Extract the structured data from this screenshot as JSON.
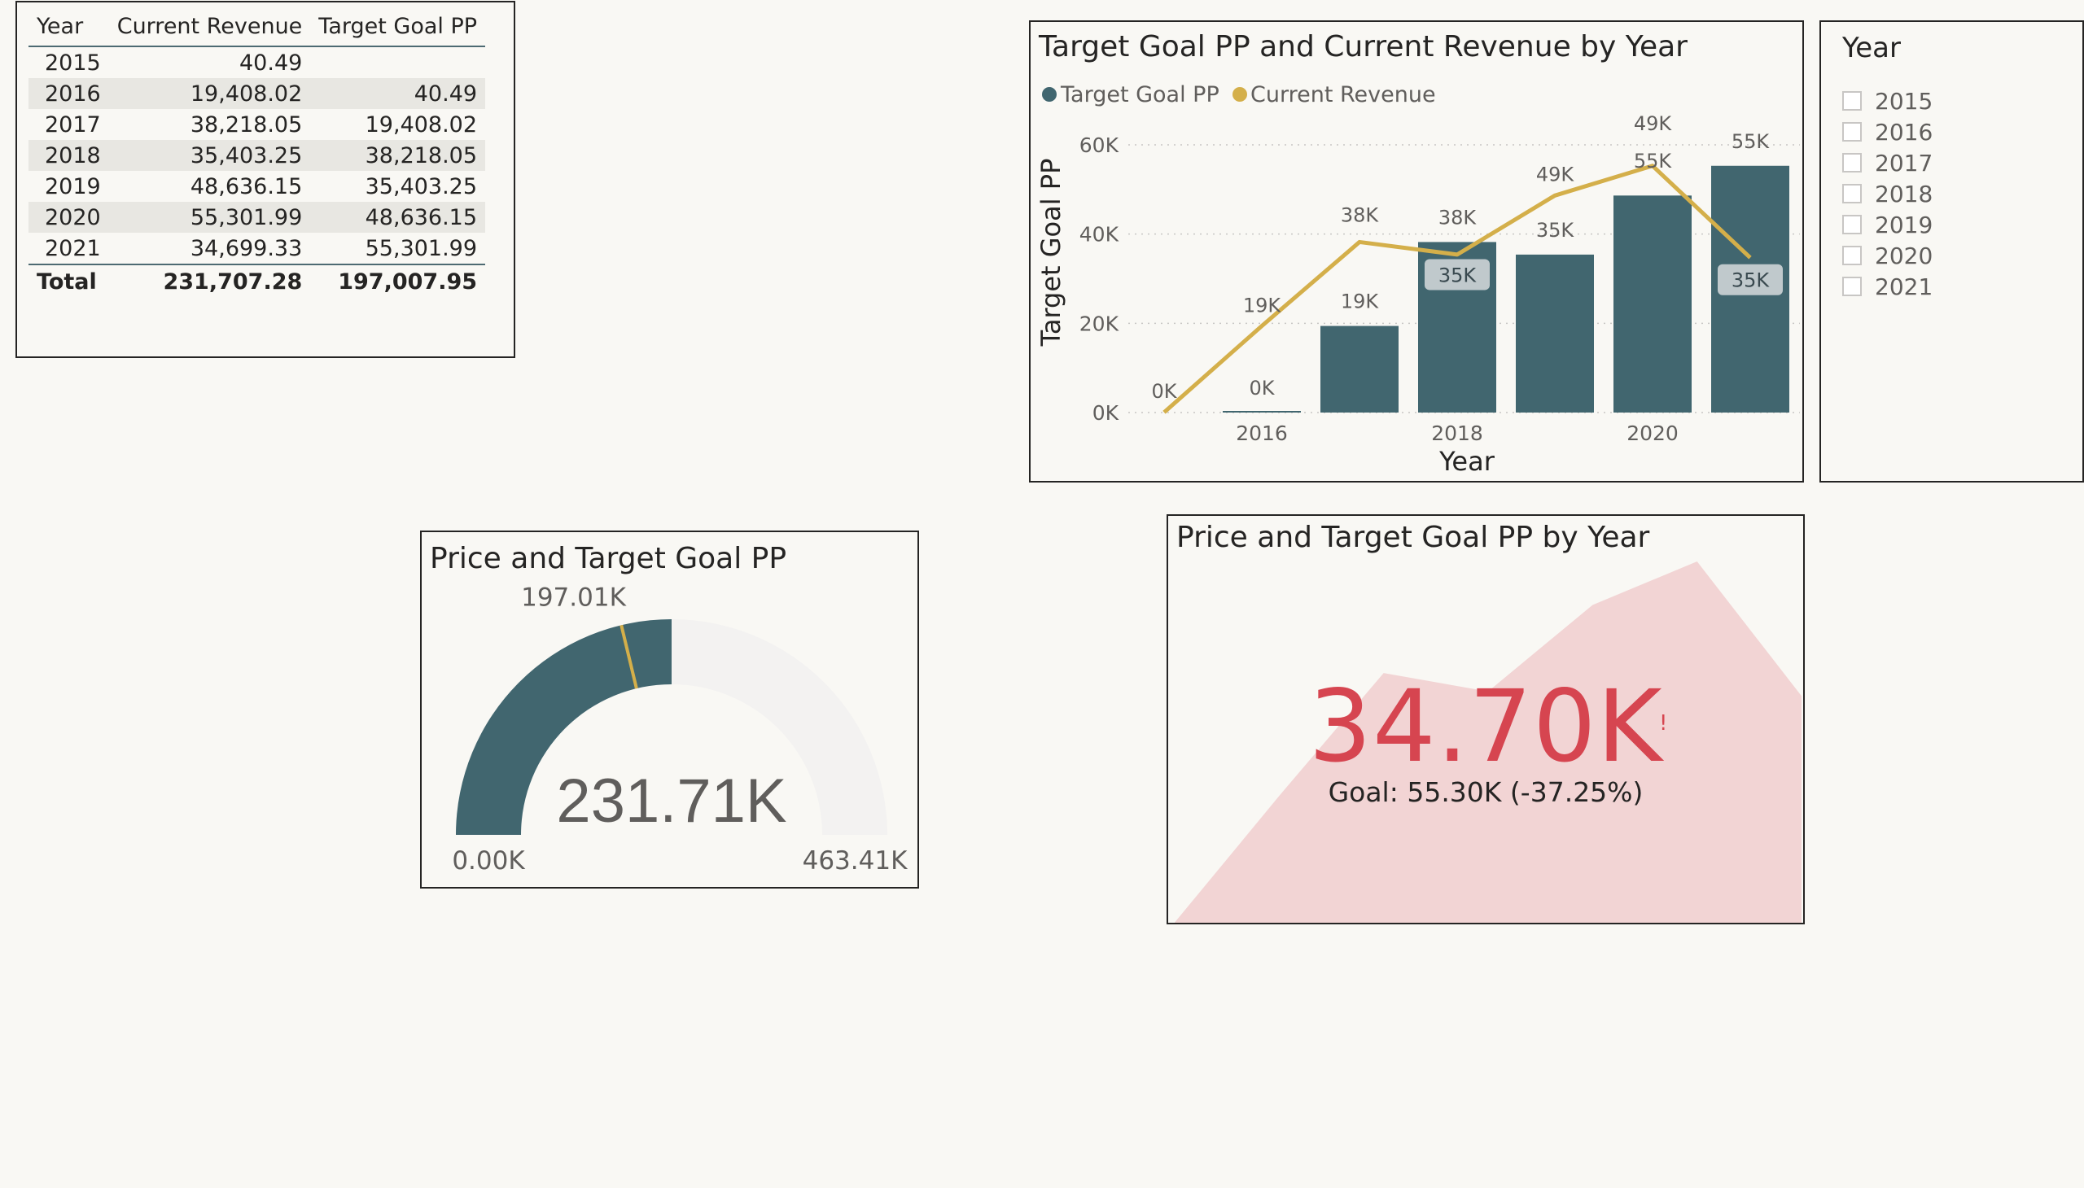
{
  "table": {
    "headers": [
      "Year",
      "Current Revenue",
      "Target Goal PP"
    ],
    "rows": [
      [
        "2015",
        "40.49",
        ""
      ],
      [
        "2016",
        "19,408.02",
        "40.49"
      ],
      [
        "2017",
        "38,218.05",
        "19,408.02"
      ],
      [
        "2018",
        "35,403.25",
        "38,218.05"
      ],
      [
        "2019",
        "48,636.15",
        "35,403.25"
      ],
      [
        "2020",
        "55,301.99",
        "48,636.15"
      ],
      [
        "2021",
        "34,699.33",
        "55,301.99"
      ]
    ],
    "total": [
      "Total",
      "231,707.28",
      "197,007.95"
    ]
  },
  "combo": {
    "title": "Target Goal PP and Current Revenue by Year",
    "legend": [
      {
        "label": "Target Goal PP",
        "color": "#41666f"
      },
      {
        "label": "Current Revenue",
        "color": "#d4af4a"
      }
    ],
    "xlabel": "Year",
    "ylabel": "Target Goal PP",
    "x_tick_labels": [
      "2016",
      "2018",
      "2020"
    ],
    "y_tick_labels": [
      "0K",
      "20K",
      "40K",
      "60K"
    ]
  },
  "chart_data": {
    "type": "bar",
    "title": "Target Goal PP and Current Revenue by Year",
    "categories": [
      "2015",
      "2016",
      "2017",
      "2018",
      "2019",
      "2020",
      "2021"
    ],
    "series": [
      {
        "name": "Target Goal PP",
        "kind": "bar",
        "color": "#41666f",
        "values": [
          0,
          40.49,
          19408.02,
          38218.05,
          35403.25,
          48636.15,
          55301.99
        ],
        "labels": [
          "",
          "0K",
          "19K",
          "38K",
          "35K",
          "49K",
          "55K"
        ]
      },
      {
        "name": "Current Revenue",
        "kind": "line",
        "color": "#d4af4a",
        "values": [
          40.49,
          19408.02,
          38218.05,
          35403.25,
          48636.15,
          55301.99,
          34699.33
        ],
        "labels": [
          "0K",
          "19K",
          "38K",
          "35K",
          "49K",
          "55K",
          "35K"
        ]
      }
    ],
    "xlabel": "Year",
    "ylabel": "Target Goal PP",
    "ylim": [
      0,
      60000
    ],
    "y_ticks": [
      0,
      20000,
      40000,
      60000
    ],
    "grid": true,
    "legend": "top-left"
  },
  "slicer": {
    "title": "Year",
    "items": [
      "2015",
      "2016",
      "2017",
      "2018",
      "2019",
      "2020",
      "2021"
    ]
  },
  "gauge": {
    "title": "Price and Target Goal PP",
    "value_label": "231.71K",
    "target_label": "197.01K",
    "min_label": "0.00K",
    "max_label": "463.41K",
    "value": 231707.28,
    "target": 197007.95,
    "min": 0,
    "max": 463414.56,
    "fill_color": "#41666f",
    "track_color": "#f3f2f1",
    "target_color": "#d4af4a"
  },
  "kpi": {
    "title": "Price and Target Goal PP by Year",
    "value_label": "34.70K",
    "indicator": "!",
    "goal_label": "Goal: 55.30K (-37.25%)",
    "trend_values": [
      40.49,
      19408.02,
      38218.05,
      35403.25,
      48636.15,
      55301.99,
      34699.33
    ],
    "value_color": "#d64550",
    "trend_color": "#f2d4d4"
  }
}
